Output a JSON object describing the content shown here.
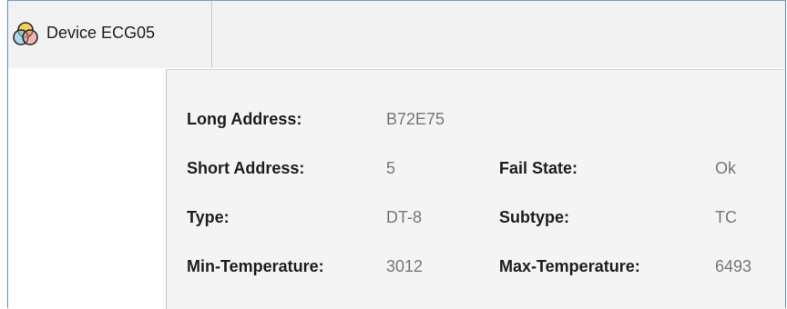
{
  "tab": {
    "icon": "rgb-circles-icon",
    "label": "Device ECG05"
  },
  "details": {
    "long_address": {
      "label": "Long Address:",
      "value": "B72E75"
    },
    "short_address": {
      "label": "Short Address:",
      "value": "5"
    },
    "fail_state": {
      "label": "Fail State:",
      "value": "Ok"
    },
    "type": {
      "label": "Type:",
      "value": "DT-8"
    },
    "subtype": {
      "label": "Subtype:",
      "value": "TC"
    },
    "min_temperature": {
      "label": "Min-Temperature:",
      "value": "3012"
    },
    "max_temperature": {
      "label": "Max-Temperature:",
      "value": "6493"
    }
  },
  "colors": {
    "accent_border": "#5b8fc9",
    "label_text": "#1e1e1e",
    "value_text": "#767676"
  }
}
